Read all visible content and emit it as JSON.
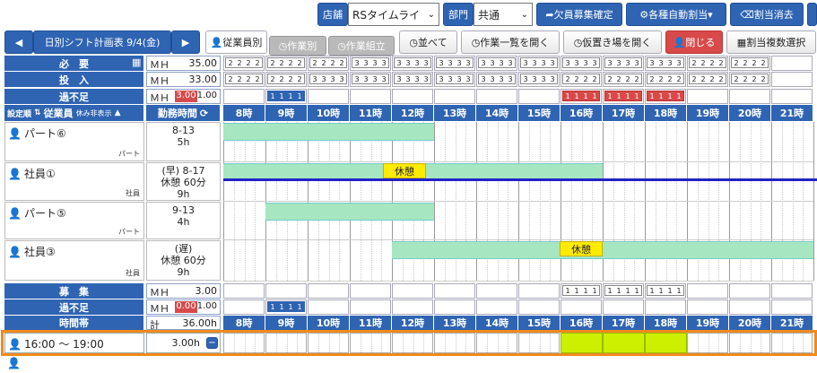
{
  "toolbar": {
    "store_label": "店舗",
    "store_value": "RSタイムライ",
    "dept_label": "部門",
    "dept_value": "共通",
    "btn_shortage": "欠員募集確定",
    "btn_auto": "各種自動割当",
    "btn_clear": "割当消去"
  },
  "nav": {
    "title": "日別シフト計画表 9/4(金)",
    "tab_staff": "従業員別",
    "tab_task": "作業別",
    "tab_assemble": "作業組立",
    "btn_sort": "並べて",
    "btn_tasklist": "作業一覧を開く",
    "btn_temp": "仮置き場を開く",
    "btn_close": "閉じる",
    "btn_multi": "割当複数選択"
  },
  "summary": {
    "need_label": "必　要",
    "need_mh_label": "ＭＨ",
    "need_mh_value": "35.00",
    "input_label": "投　入",
    "input_mh_label": "ＭＨ",
    "input_mh_value": "33.00",
    "excess_label": "過不足",
    "excess_mh_label": "ＭＨ",
    "excess_red": "3.00",
    "excess_blue": "1.00"
  },
  "header": {
    "order_label": "設定順",
    "employee_label": "従業員",
    "hide_rest": "休み非表示",
    "work_time": "勤務時間"
  },
  "hours": [
    "8時",
    "9時",
    "10時",
    "11時",
    "12時",
    "13時",
    "14時",
    "15時",
    "16時",
    "17時",
    "18時",
    "19時",
    "20時",
    "21時"
  ],
  "need_slots": [
    "2 2 2 2",
    "2 2 2 2",
    "2 2 2 2",
    "3 3 3 3",
    "3 3 3 3",
    "3 3 3 3",
    "3 3 3 3",
    "3 3 3 3",
    "3 3 3 3",
    "3 3 3 3",
    "3 3 3 3",
    "2 2 2 2",
    "2 2 2 2",
    ""
  ],
  "input_slots": [
    "2 2 2 2",
    "2 2 2 2",
    "3 3 3 3",
    "3 3 3 3",
    "3 3 3 3",
    "3 3 3 3",
    "3 3 3 3",
    "3 3 3 3",
    "2 2 2 2",
    "2 2 2 2",
    "2 2 2 2",
    "2 2 2 2",
    "2 2 2 2",
    ""
  ],
  "excess_blue_slot": "1 1 1 1",
  "excess_red_slot": "1 1 1 1",
  "employees": [
    {
      "name": "パート⑥",
      "type": "パート",
      "time": "8-13",
      "hours": "5h",
      "rest": ""
    },
    {
      "name": "社員①",
      "type": "社員",
      "time": "(早) 8-17",
      "break": "休憩 60分",
      "hours": "9h",
      "rest": "休憩"
    },
    {
      "name": "パート⑤",
      "type": "パート",
      "time": "9-13",
      "hours": "4h",
      "rest": ""
    },
    {
      "name": "社員③",
      "type": "社員",
      "time": "(遅)",
      "break": "休憩 60分",
      "hours": "9h",
      "rest": "休憩"
    }
  ],
  "footer": {
    "recruit_label": "募　集",
    "recruit_mh_label": "ＭＨ",
    "recruit_mh_value": "3.00",
    "excess_label": "過不足",
    "excess_mh_label": "ＭＨ",
    "excess_red": "0.00",
    "excess_blue": "1.00",
    "timeband_label": "時間帯",
    "total_label": "計",
    "total_value": "36.00h",
    "recruit_slot": "1 1 1 1",
    "excess_slot": "1 1 1 1"
  },
  "recruit_row": {
    "time": "16:00 〜 19:00",
    "hours": "3.00h"
  }
}
